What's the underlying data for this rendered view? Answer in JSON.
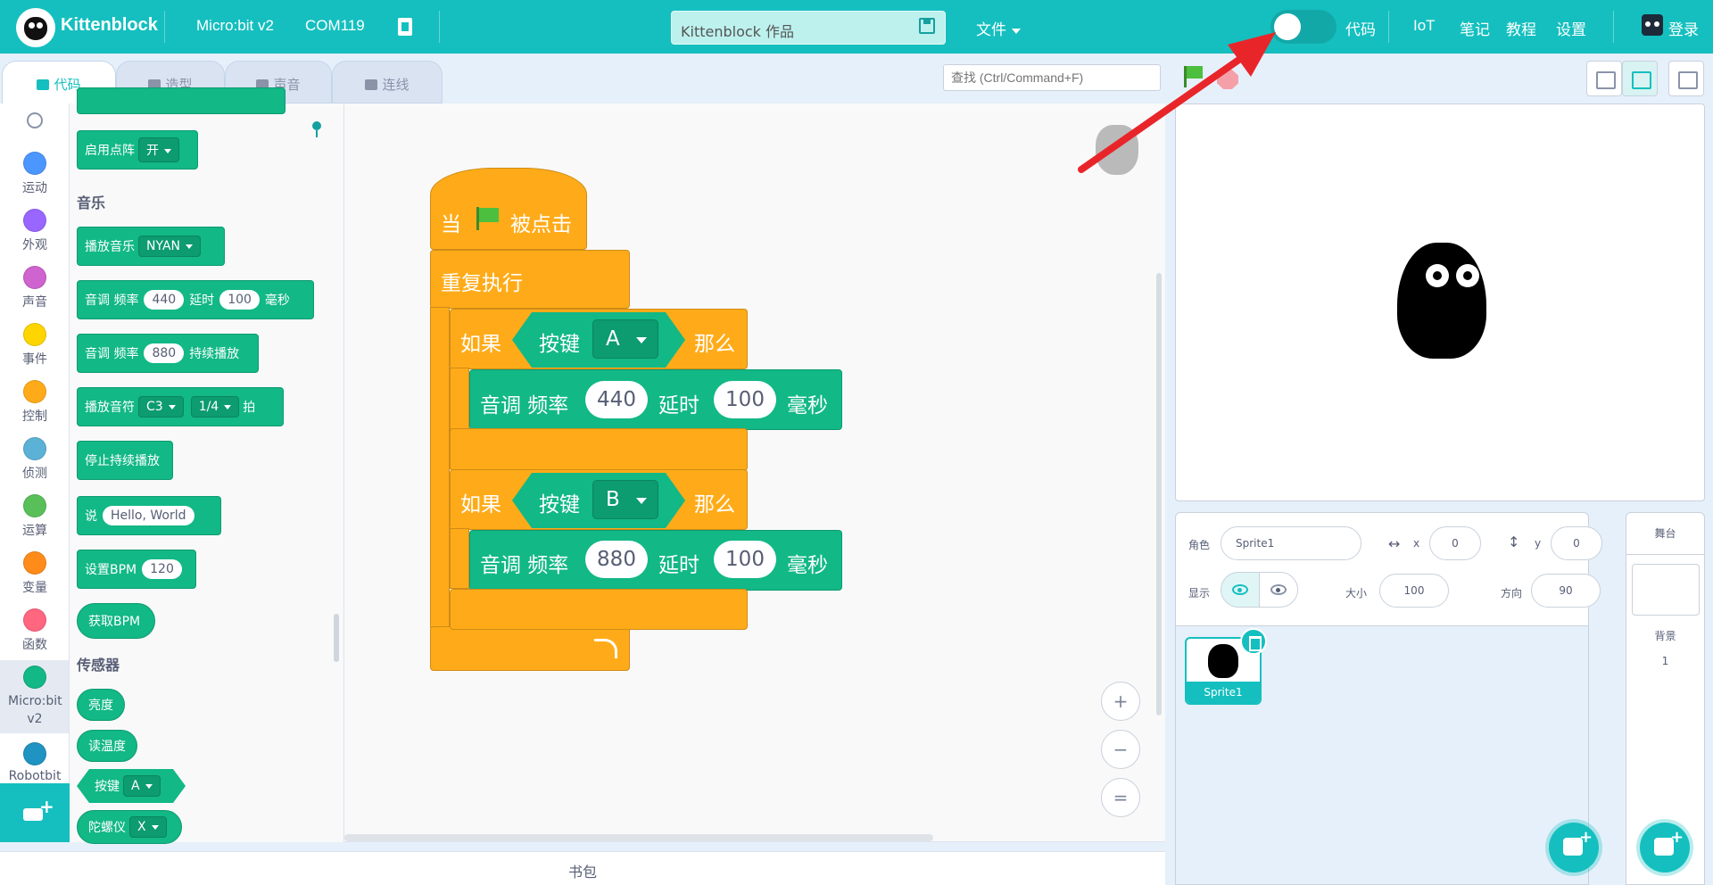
{
  "header": {
    "brand": "Kittenblock",
    "device": "Micro:bit v2",
    "port": "COM119",
    "project_title": "Kittenblock 作品",
    "file_menu": "文件",
    "code_toggle_label": "代码",
    "nav": [
      "IoT",
      "笔记",
      "教程",
      "设置"
    ],
    "login": "登录",
    "accent": "#15bfbf"
  },
  "tabs": [
    {
      "label": "代码",
      "icon": "code-icon"
    },
    {
      "label": "造型",
      "icon": "brush-icon"
    },
    {
      "label": "声音",
      "icon": "speaker-icon"
    },
    {
      "label": "连线",
      "icon": "wire-icon"
    }
  ],
  "search": {
    "placeholder": "查找 (Ctrl/Command+F)"
  },
  "categories": [
    {
      "label": "运动",
      "color": "#4c97ff"
    },
    {
      "label": "外观",
      "color": "#9966ff"
    },
    {
      "label": "声音",
      "color": "#cf63cf"
    },
    {
      "label": "事件",
      "color": "#ffd500"
    },
    {
      "label": "控制",
      "color": "#ffab19"
    },
    {
      "label": "侦测",
      "color": "#5cb1d6"
    },
    {
      "label": "运算",
      "color": "#59c059"
    },
    {
      "label": "变量",
      "color": "#ff8c1a"
    },
    {
      "label": "函数",
      "color": "#ff6680"
    },
    {
      "label": "Micro:bit v2",
      "color": "#12b886"
    },
    {
      "label": "Robotbit",
      "color": "#1f93c1"
    }
  ],
  "palette": {
    "matrix_block": {
      "label": "启用点阵",
      "value": "开"
    },
    "music_title": "音乐",
    "play_music": {
      "label": "播放音乐",
      "value": "NYAN"
    },
    "tone_delay": {
      "a": "音调 频率",
      "freq": "440",
      "b": "延时",
      "delay": "100",
      "c": "毫秒"
    },
    "tone_hold": {
      "a": "音调 频率",
      "freq": "880",
      "b": "持续播放"
    },
    "play_note": {
      "a": "播放音符",
      "note": "C3",
      "beat": "1/4",
      "b": "拍"
    },
    "stop_tone": "停止持续播放",
    "say": {
      "a": "说",
      "text": "Hello, World"
    },
    "set_bpm": {
      "a": "设置BPM",
      "value": "120"
    },
    "get_bpm": "获取BPM",
    "sensors_title": "传感器",
    "brightness": "亮度",
    "temperature": "读温度",
    "button": {
      "a": "按键",
      "value": "A"
    },
    "gyro": {
      "a": "陀螺仪",
      "value": "X"
    }
  },
  "script": {
    "hat_when": "当",
    "hat_clicked": "被点击",
    "forever": "重复执行",
    "if1": {
      "if": "如果",
      "key": "按键",
      "value": "A",
      "then": "那么",
      "tone": "音调 频率",
      "freq": "440",
      "delay_label": "延时",
      "delay": "100",
      "unit": "毫秒"
    },
    "if2": {
      "if": "如果",
      "key": "按键",
      "value": "B",
      "then": "那么",
      "tone": "音调 频率",
      "freq": "880",
      "delay_label": "延时",
      "delay": "100",
      "unit": "毫秒"
    }
  },
  "backpack": "书包",
  "sprite_info": {
    "sprite_label": "角色",
    "sprite_name": "Sprite1",
    "x_label": "x",
    "x": "0",
    "y_label": "y",
    "y": "0",
    "show_label": "显示",
    "size_label": "大小",
    "size": "100",
    "direction_label": "方向",
    "direction": "90"
  },
  "sprites": [
    {
      "name": "Sprite1"
    }
  ],
  "stage_panel": {
    "title": "舞台",
    "backdrop_label": "背景",
    "backdrop_count": "1"
  }
}
